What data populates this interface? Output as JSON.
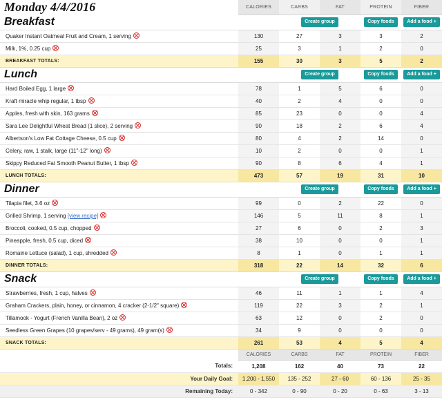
{
  "page_title": "Monday 4/4/2016",
  "columns": [
    "CALORIES",
    "CARBS",
    "FAT",
    "PROTEIN",
    "FIBER"
  ],
  "buttons": {
    "create_group": "Create group",
    "copy_foods": "Copy foods",
    "add_food": "Add a food +"
  },
  "meals": [
    {
      "title": "Breakfast",
      "items": [
        {
          "name": "Quaker Instant Oatmeal Fruit and Cream, 1 serving",
          "cal": "130",
          "carb": "27",
          "fat": "3",
          "prot": "3",
          "fib": "2"
        },
        {
          "name": "Milk, 1%, 0.25 cup",
          "cal": "25",
          "carb": "3",
          "fat": "1",
          "prot": "2",
          "fib": "0"
        }
      ],
      "totals_label": "BREAKFAST TOTALS:",
      "totals": {
        "cal": "155",
        "carb": "30",
        "fat": "3",
        "prot": "5",
        "fib": "2"
      }
    },
    {
      "title": "Lunch",
      "items": [
        {
          "name": "Hard Boiled Egg, 1 large",
          "cal": "78",
          "carb": "1",
          "fat": "5",
          "prot": "6",
          "fib": "0"
        },
        {
          "name": "Kraft miracle whip regular, 1 tbsp",
          "cal": "40",
          "carb": "2",
          "fat": "4",
          "prot": "0",
          "fib": "0"
        },
        {
          "name": "Apples, fresh with skin, 163 grams",
          "cal": "85",
          "carb": "23",
          "fat": "0",
          "prot": "0",
          "fib": "4"
        },
        {
          "name": "Sara Lee Delightful Wheat Bread (1 slice), 2 serving",
          "cal": "90",
          "carb": "18",
          "fat": "2",
          "prot": "6",
          "fib": "4"
        },
        {
          "name": "Albertson's Low Fat Cottage Cheese, 0.5 cup",
          "cal": "80",
          "carb": "4",
          "fat": "2",
          "prot": "14",
          "fib": "0"
        },
        {
          "name": "Celery, raw, 1 stalk, large (11\"-12\" long)",
          "cal": "10",
          "carb": "2",
          "fat": "0",
          "prot": "0",
          "fib": "1"
        },
        {
          "name": "Skippy Reduced Fat Smooth Peanut Butter, 1 tbsp",
          "cal": "90",
          "carb": "8",
          "fat": "6",
          "prot": "4",
          "fib": "1"
        }
      ],
      "totals_label": "LUNCH TOTALS:",
      "totals": {
        "cal": "473",
        "carb": "57",
        "fat": "19",
        "prot": "31",
        "fib": "10"
      }
    },
    {
      "title": "Dinner",
      "items": [
        {
          "name": "Tilapia filet, 3.6 oz",
          "cal": "99",
          "carb": "0",
          "fat": "2",
          "prot": "22",
          "fib": "0"
        },
        {
          "name": "Grilled Shrimp, 1 serving",
          "recipe": "[view recipe]",
          "cal": "146",
          "carb": "5",
          "fat": "11",
          "prot": "8",
          "fib": "1"
        },
        {
          "name": "Broccoli, cooked, 0.5 cup, chopped",
          "cal": "27",
          "carb": "6",
          "fat": "0",
          "prot": "2",
          "fib": "3"
        },
        {
          "name": "Pineapple, fresh, 0.5 cup, diced",
          "cal": "38",
          "carb": "10",
          "fat": "0",
          "prot": "0",
          "fib": "1"
        },
        {
          "name": "Romaine Lettuce (salad), 1 cup, shredded",
          "cal": "8",
          "carb": "1",
          "fat": "0",
          "prot": "1",
          "fib": "1"
        }
      ],
      "totals_label": "DINNER TOTALS:",
      "totals": {
        "cal": "318",
        "carb": "22",
        "fat": "14",
        "prot": "32",
        "fib": "6"
      }
    },
    {
      "title": "Snack",
      "items": [
        {
          "name": "Strawberries, fresh, 1 cup, halves",
          "cal": "46",
          "carb": "11",
          "fat": "1",
          "prot": "1",
          "fib": "4"
        },
        {
          "name": "Graham Crackers, plain, honey, or cinnamon, 4 cracker (2-1/2\" square)",
          "cal": "119",
          "carb": "22",
          "fat": "3",
          "prot": "2",
          "fib": "1"
        },
        {
          "name": "Tillamook - Yogurt (French Vanilla Bean), 2 oz",
          "cal": "63",
          "carb": "12",
          "fat": "0",
          "prot": "2",
          "fib": "0"
        },
        {
          "name": "Seedless Green Grapes (10 grapes/serv - 49 grams), 49 gram(s)",
          "cal": "34",
          "carb": "9",
          "fat": "0",
          "prot": "0",
          "fib": "0"
        }
      ],
      "totals_label": "SNACK TOTALS:",
      "totals": {
        "cal": "261",
        "carb": "53",
        "fat": "4",
        "prot": "5",
        "fib": "4"
      }
    }
  ],
  "summary": {
    "totals_label": "Totals:",
    "totals": {
      "cal": "1,208",
      "carb": "162",
      "fat": "40",
      "prot": "73",
      "fib": "22"
    },
    "goal_label": "Your Daily Goal:",
    "goal": {
      "cal": "1,200 - 1,550",
      "carb": "135 - 252",
      "fat": "27 - 60",
      "prot": "60 - 136",
      "fib": "25 - 35"
    },
    "remaining_label": "Remaining Today:",
    "remaining": {
      "cal": "0 - 342",
      "carb": "0 - 90",
      "fat": "0 - 20",
      "prot": "0 - 63",
      "fib": "3 - 13"
    }
  },
  "icons": {
    "delete": "delete-circle-x-icon"
  },
  "colors": {
    "button": "#1a9a9a",
    "totals_row": "#fdf5c9",
    "delete_icon": "#d83030"
  }
}
